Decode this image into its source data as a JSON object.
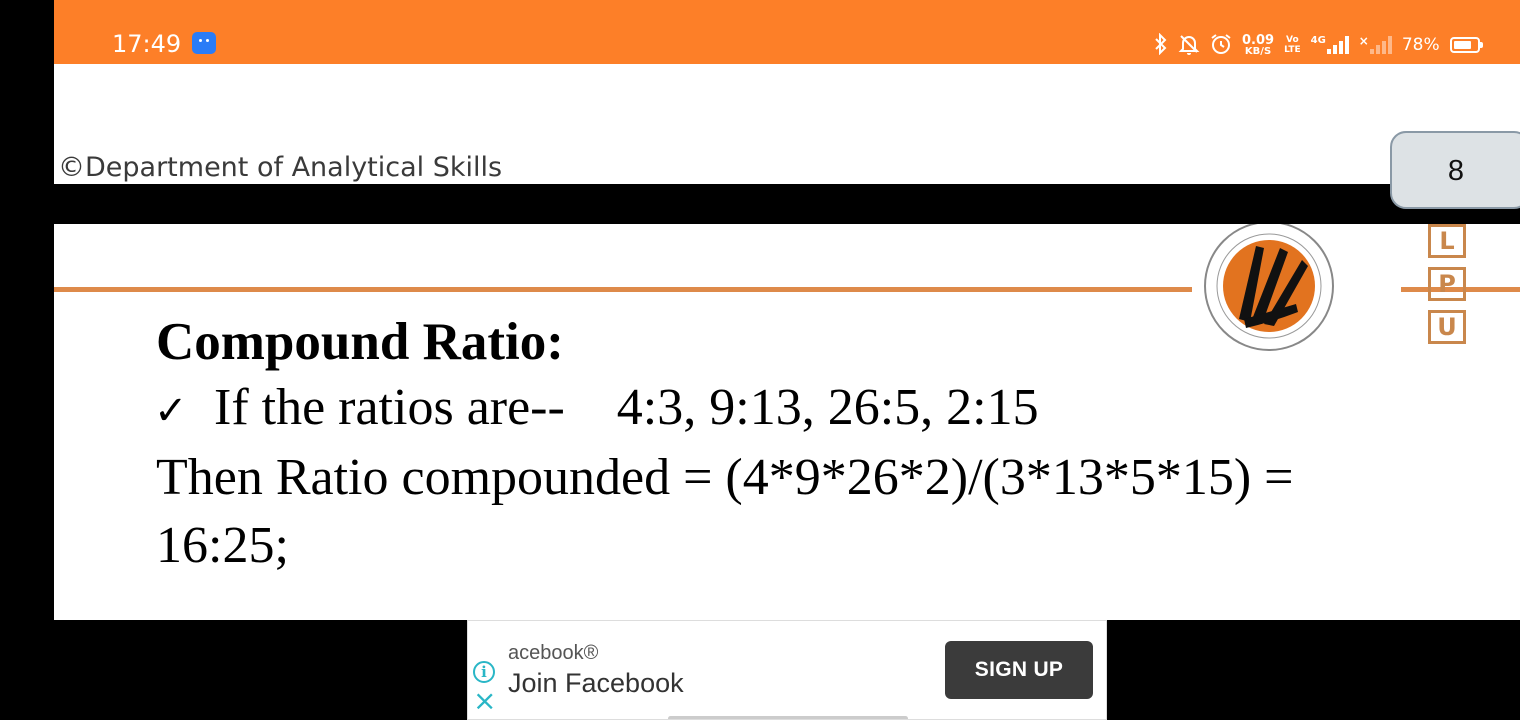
{
  "status_bar": {
    "time": "17:49",
    "app_icon": "android-app-icon",
    "icons": [
      "bluetooth-icon",
      "silent-bell-icon",
      "alarm-clock-icon"
    ],
    "net_speed_value": "0.09",
    "net_speed_unit": "KB/S",
    "volte_top": "Vo",
    "volte_bottom": "LTE",
    "network_type": "4G",
    "sim2_mark": "×",
    "battery_percent_label": "78%",
    "battery_level": 0.78,
    "background_color": "#fd7f28"
  },
  "slide": {
    "department": "©Department of Analytical Skills",
    "page_number": "8",
    "logo_letters": [
      "L",
      "P",
      "U"
    ],
    "title": "Compound Ratio:",
    "bullet_symbol": "✓",
    "bullet_text": "If the ratios are--",
    "ratios": "4:3, 9:13, 26:5, 2:15",
    "result_line": "Then Ratio compounded = (4*9*26*2)/(3*13*5*15) =",
    "result_value": "16:25;",
    "accent_color": "#de8a4a"
  },
  "ad": {
    "brand": "acebook®",
    "headline": "Join Facebook",
    "cta": "SIGN UP",
    "info_icon": "info-icon",
    "close_icon": "close-icon"
  }
}
